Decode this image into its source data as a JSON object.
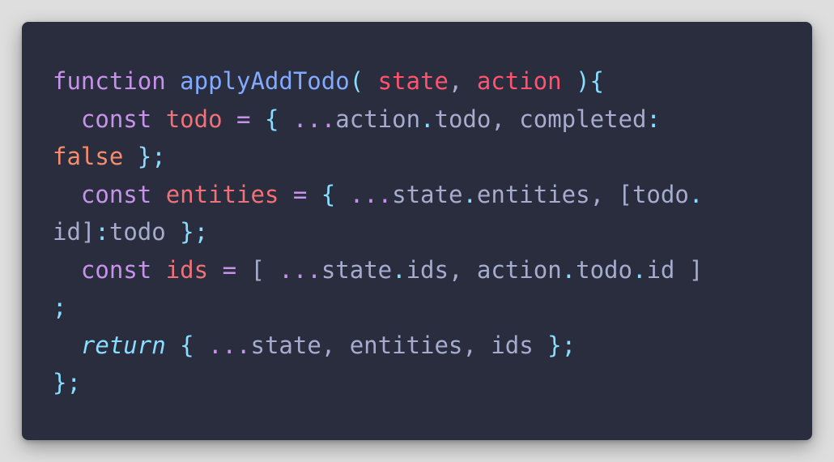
{
  "code_lines": [
    [
      {
        "t": "function",
        "c": "kw"
      },
      {
        "t": " ",
        "c": "ident"
      },
      {
        "t": "applyAddTodo",
        "c": "fn"
      },
      {
        "t": "( ",
        "c": "punc"
      },
      {
        "t": "state",
        "c": "param"
      },
      {
        "t": ", ",
        "c": "ident"
      },
      {
        "t": "action",
        "c": "param"
      },
      {
        "t": " ",
        "c": "ident"
      },
      {
        "t": "){",
        "c": "punc"
      }
    ],
    [
      {
        "t": "  ",
        "c": "ident"
      },
      {
        "t": "const",
        "c": "kw"
      },
      {
        "t": " ",
        "c": "ident"
      },
      {
        "t": "todo",
        "c": "var"
      },
      {
        "t": " ",
        "c": "ident"
      },
      {
        "t": "=",
        "c": "kw"
      },
      {
        "t": " ",
        "c": "ident"
      },
      {
        "t": "{",
        "c": "punc"
      },
      {
        "t": " ",
        "c": "ident"
      },
      {
        "t": "...",
        "c": "kw"
      },
      {
        "t": "action",
        "c": "ident"
      },
      {
        "t": ".",
        "c": "punc"
      },
      {
        "t": "todo, completed",
        "c": "ident"
      },
      {
        "t": ":",
        "c": "punc"
      }
    ],
    [
      {
        "t": "false",
        "c": "bool"
      },
      {
        "t": " ",
        "c": "ident"
      },
      {
        "t": "};",
        "c": "punc"
      }
    ],
    [
      {
        "t": "  ",
        "c": "ident"
      },
      {
        "t": "const",
        "c": "kw"
      },
      {
        "t": " ",
        "c": "ident"
      },
      {
        "t": "entities",
        "c": "var"
      },
      {
        "t": " ",
        "c": "ident"
      },
      {
        "t": "=",
        "c": "kw"
      },
      {
        "t": " ",
        "c": "ident"
      },
      {
        "t": "{",
        "c": "punc"
      },
      {
        "t": " ",
        "c": "ident"
      },
      {
        "t": "...",
        "c": "kw"
      },
      {
        "t": "state",
        "c": "ident"
      },
      {
        "t": ".",
        "c": "punc"
      },
      {
        "t": "entities, [todo",
        "c": "ident"
      },
      {
        "t": ".",
        "c": "punc"
      }
    ],
    [
      {
        "t": "id]",
        "c": "ident"
      },
      {
        "t": ":",
        "c": "punc"
      },
      {
        "t": "todo",
        "c": "ident"
      },
      {
        "t": " ",
        "c": "ident"
      },
      {
        "t": "};",
        "c": "punc"
      }
    ],
    [
      {
        "t": "  ",
        "c": "ident"
      },
      {
        "t": "const",
        "c": "kw"
      },
      {
        "t": " ",
        "c": "ident"
      },
      {
        "t": "ids",
        "c": "var"
      },
      {
        "t": " ",
        "c": "ident"
      },
      {
        "t": "=",
        "c": "kw"
      },
      {
        "t": " [ ",
        "c": "ident"
      },
      {
        "t": "...",
        "c": "kw"
      },
      {
        "t": "state",
        "c": "ident"
      },
      {
        "t": ".",
        "c": "punc"
      },
      {
        "t": "ids, action",
        "c": "ident"
      },
      {
        "t": ".",
        "c": "punc"
      },
      {
        "t": "todo",
        "c": "ident"
      },
      {
        "t": ".",
        "c": "punc"
      },
      {
        "t": "id ]",
        "c": "ident"
      }
    ],
    [
      {
        "t": ";",
        "c": "punc"
      }
    ],
    [
      {
        "t": "  ",
        "c": "ident"
      },
      {
        "t": "return",
        "c": "kw-i"
      },
      {
        "t": " ",
        "c": "ident"
      },
      {
        "t": "{",
        "c": "punc"
      },
      {
        "t": " ",
        "c": "ident"
      },
      {
        "t": "...",
        "c": "kw"
      },
      {
        "t": "state, entities, ids ",
        "c": "ident"
      },
      {
        "t": "};",
        "c": "punc"
      }
    ],
    [
      {
        "t": "};",
        "c": "punc"
      }
    ]
  ],
  "colors": {
    "background": "#292d3e",
    "keyword": "#c792ea",
    "function": "#82aaff",
    "parameter": "#ff5370",
    "variable": "#f07178",
    "boolean": "#f78c6c",
    "punctuation": "#89ddff",
    "text": "#a6accd"
  }
}
